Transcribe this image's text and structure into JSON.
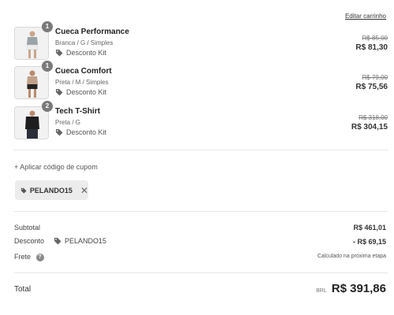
{
  "cart": {
    "edit_label": "Editar carrinho",
    "items": [
      {
        "name": "Cueca Performance",
        "variant": "Branca / G / Simples",
        "discount": "Desconto Kit",
        "old_price": "R$ 85,00",
        "price": "R$ 81,30",
        "quantity": "1"
      },
      {
        "name": "Cueca Comfort",
        "variant": "Preta / M / Simples",
        "discount": "Desconto Kit",
        "old_price": "R$ 79,00",
        "price": "R$ 75,56",
        "quantity": "1"
      },
      {
        "name": "Tech T-Shirt",
        "variant": "Preta / G",
        "discount": "Desconto Kit",
        "old_price": "R$ 318,00",
        "price": "R$ 304,15",
        "quantity": "2"
      }
    ]
  },
  "coupon": {
    "link_label": "+ Aplicar código de cupom",
    "applied_code": "PELANDO15"
  },
  "summary": {
    "subtotal_label": "Subtotal",
    "subtotal_value": "R$ 461,01",
    "discount_label": "Desconto",
    "discount_code": "PELANDO15",
    "discount_value": "- R$ 69,15",
    "shipping_label": "Frete",
    "shipping_value": "Calculado na próxima etapa",
    "total_label": "Total",
    "currency": "BRL",
    "total_value": "R$ 391,86"
  },
  "icons": {
    "tag": "tag-icon",
    "close": "close-icon",
    "help": "help-icon"
  },
  "colors": {
    "badge": "#7a7a7a",
    "chip_bg": "#ececec",
    "divider": "#e6e6e6"
  }
}
